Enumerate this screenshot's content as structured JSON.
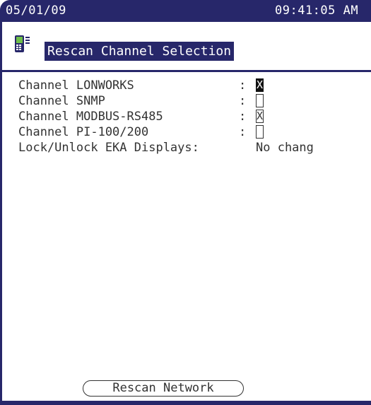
{
  "status_bar": {
    "date": "05/01/09",
    "time": "09:41:05 AM"
  },
  "header": {
    "title": "Rescan Channel Selection",
    "icon": "handheld-device-icon"
  },
  "channels": [
    {
      "label": "Channel LONWORKS",
      "colon": ":",
      "checked": true,
      "mark": "X",
      "focused": true
    },
    {
      "label": "Channel SNMP",
      "colon": ":",
      "checked": false,
      "mark": "",
      "focused": false
    },
    {
      "label": "Channel MODBUS-RS485",
      "colon": ":",
      "checked": true,
      "mark": "X",
      "focused": false
    },
    {
      "label": "Channel PI-100/200",
      "colon": ":",
      "checked": false,
      "mark": "",
      "focused": false
    }
  ],
  "lock": {
    "label": "Lock/Unlock EKA Displays",
    "colon": ":",
    "value": "No chang"
  },
  "footer": {
    "rescan_label": "Rescan Network"
  },
  "colors": {
    "accent": "#27276a",
    "text": "#333333",
    "background": "#ffffff"
  }
}
